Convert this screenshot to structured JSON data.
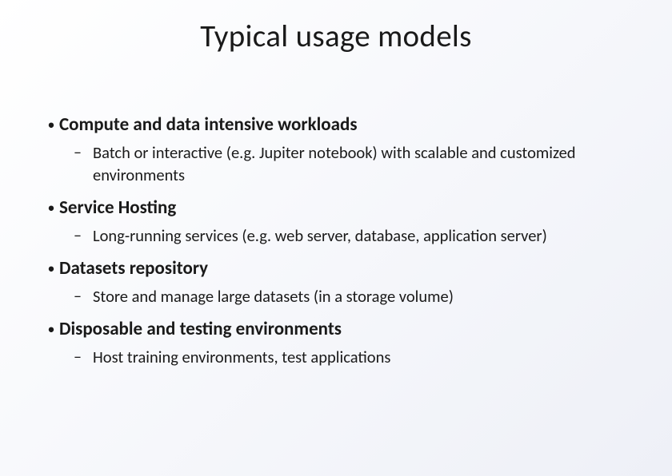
{
  "title": "Typical usage models",
  "items": [
    {
      "heading": "Compute and data intensive workloads",
      "sub": "Batch or interactive (e.g. Jupiter notebook) with scalable and customized environments"
    },
    {
      "heading": "Service Hosting",
      "sub": "Long-running services (e.g. web server, database, application server)"
    },
    {
      "heading": "Datasets repository",
      "sub": "Store and manage large datasets (in a storage volume)"
    },
    {
      "heading": "Disposable and testing environments",
      "sub": "Host training environments, test applications"
    }
  ]
}
